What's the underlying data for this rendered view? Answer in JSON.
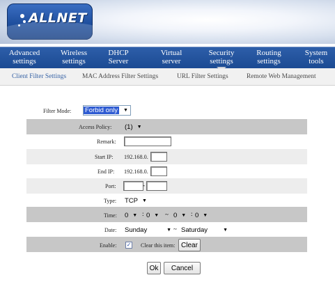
{
  "brand": {
    "logo": "ALLNET"
  },
  "main_nav": [
    {
      "line1": "Advanced",
      "line2": "settings"
    },
    {
      "line1": "Wireless",
      "line2": "settings"
    },
    {
      "line1": "DHCP",
      "line2": "Server"
    },
    {
      "line1": "Virtual",
      "line2": "server"
    },
    {
      "line1": "Security",
      "line2": "settings"
    },
    {
      "line1": "Routing",
      "line2": "settings"
    },
    {
      "line1": "System",
      "line2": "tools"
    }
  ],
  "sub_nav": [
    "Client Filter Settings",
    "MAC Address Filter Settings",
    "URL Filter Settings",
    "Remote Web Management"
  ],
  "form": {
    "filter_mode_label": "Filter Mode:",
    "filter_mode_value": "Forbid only",
    "access_policy_label": "Access Policy:",
    "access_policy_value": "(1)",
    "remark_label": "Remark:",
    "start_ip_label": "Start IP:",
    "start_ip_prefix": "192.168.0.",
    "end_ip_label": "End IP:",
    "end_ip_prefix": "192.168.0.",
    "port_label": "Port:",
    "port_sep": "-",
    "type_label": "Type:",
    "type_value": "TCP",
    "time_label": "Time:",
    "time_start_hour": "0",
    "time_start_min": "0",
    "time_end_hour": "0",
    "time_end_min": "0",
    "time_colon": ":",
    "time_range_sep": "~",
    "date_label": "Date:",
    "date_from": "Sunday",
    "date_to": "Saturday",
    "date_range_sep": "~",
    "enable_label": "Enable:",
    "enable_checked": "✓",
    "clear_item_label": "Clear this item:",
    "clear_button": "Clear"
  },
  "actions": {
    "ok": "Ok",
    "cancel": "Cancel"
  },
  "icons": {
    "dropdown": "▼"
  }
}
